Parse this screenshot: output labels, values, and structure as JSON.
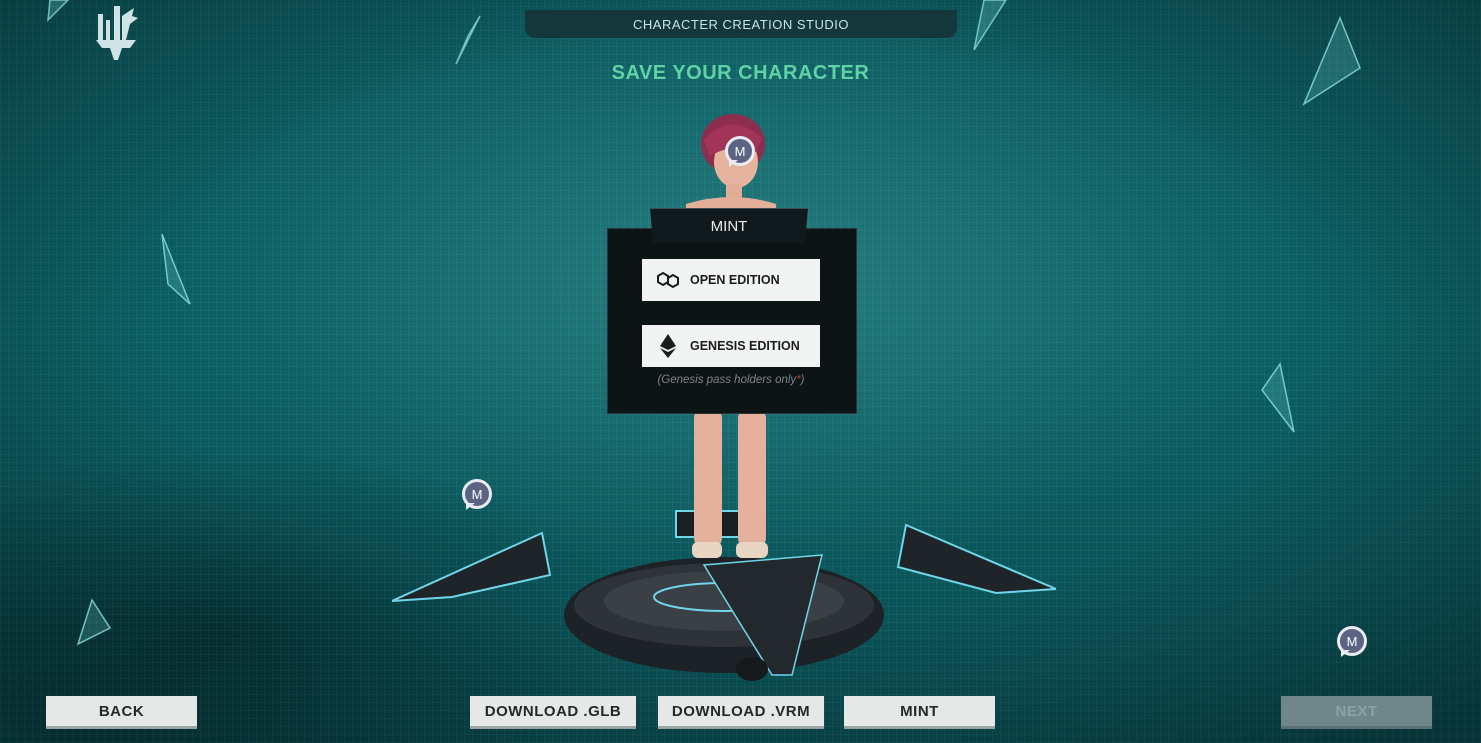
{
  "header": {
    "studio_title": "CHARACTER CREATION STUDIO",
    "page_title": "SAVE YOUR CHARACTER"
  },
  "mint_panel": {
    "tab_label": "MINT",
    "open_edition_label": "OPEN EDITION",
    "open_edition_icon": "polygon-icon",
    "genesis_edition_label": "GENESIS EDITION",
    "genesis_edition_icon": "ethereum-icon",
    "genesis_note_text": "(Genesis pass holders only",
    "genesis_note_star": "*",
    "genesis_note_close": ")"
  },
  "badges": [
    {
      "letter": "M"
    },
    {
      "letter": "M"
    },
    {
      "letter": "M"
    }
  ],
  "footer": {
    "back_label": "BACK",
    "download_glb_label": "DOWNLOAD .GLB",
    "download_vrm_label": "DOWNLOAD .VRM",
    "mint_label": "MINT",
    "next_label": "NEXT"
  },
  "colors": {
    "accent_title": "#5fd2a6",
    "background": "#0b5f63",
    "panel": "#0d1416",
    "badge": "#5c6483",
    "button": "#e6e8e8",
    "button_disabled": "#6f878b"
  }
}
